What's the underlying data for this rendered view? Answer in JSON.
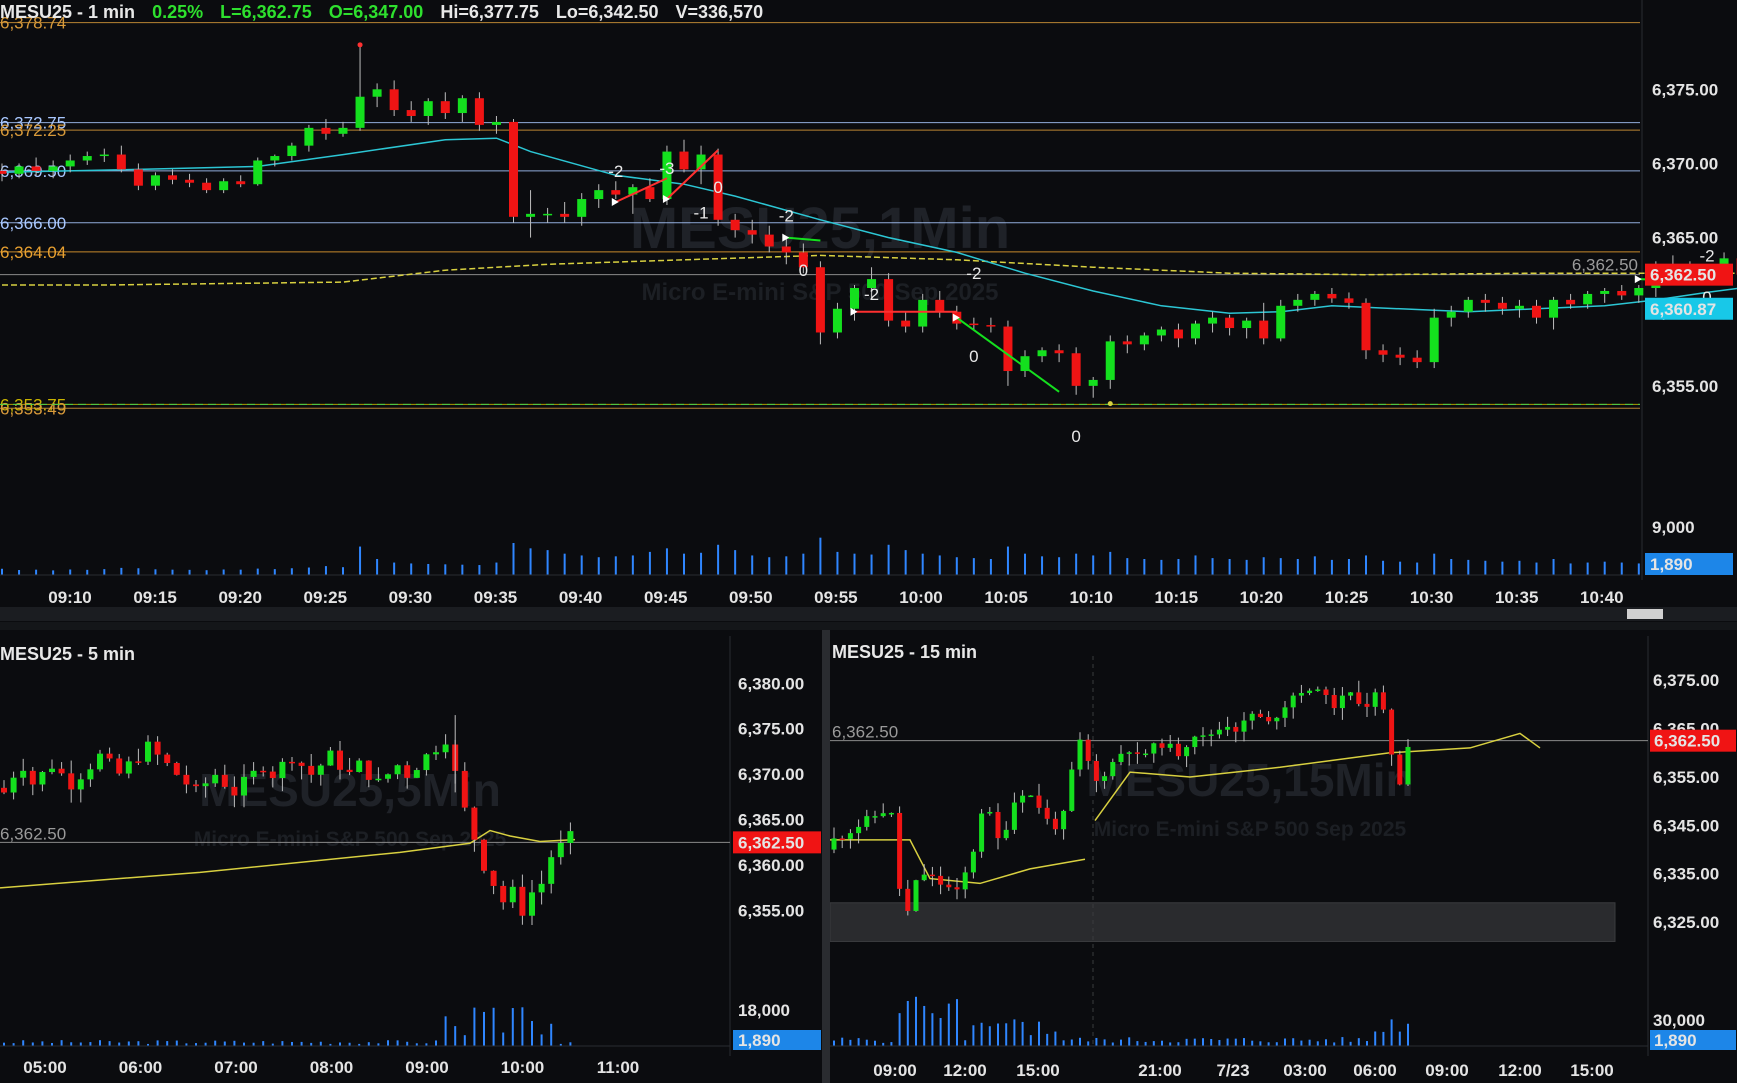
{
  "chart_data": [
    {
      "type": "candlestick",
      "symbol": "MESU25",
      "interval": "1 min",
      "header": {
        "symbol_label": "MESU25 - 1 min",
        "change": "0.25%",
        "last": "L=6,362.75",
        "open": "O=6,347.00",
        "high": "Hi=6,377.75",
        "low": "Lo=6,342.50",
        "volume": "V=336,570"
      },
      "watermark_title": "MESU25,1Min",
      "watermark_subtitle": "Micro E-mini S&P 500 Sep 2025",
      "ylim": [
        6350,
        6379
      ],
      "y_ticks": [
        "6,375.00",
        "6,370.00",
        "6,365.00",
        "6,360.00",
        "6,355.00"
      ],
      "y_tick_values": [
        6375,
        6370,
        6365,
        6360,
        6355
      ],
      "x_ticks": [
        "09:10",
        "09:15",
        "09:20",
        "09:25",
        "09:30",
        "09:35",
        "09:40",
        "09:45",
        "09:50",
        "09:55",
        "10:00",
        "10:05",
        "10:10",
        "10:15",
        "10:20",
        "10:25",
        "10:30",
        "10:35",
        "10:40"
      ],
      "x_start_minute": 0,
      "candles": [
        [
          6369.5,
          6370.0,
          6368.8,
          6369.3
        ],
        [
          6369.3,
          6370.0,
          6369.0,
          6369.8
        ],
        [
          6369.8,
          6370.4,
          6369.2,
          6369.5
        ],
        [
          6369.5,
          6370.2,
          6369.0,
          6369.8
        ],
        [
          6369.8,
          6370.6,
          6369.4,
          6370.2
        ],
        [
          6370.2,
          6370.8,
          6369.9,
          6370.5
        ],
        [
          6370.5,
          6371.0,
          6370.1,
          6370.6
        ],
        [
          6370.6,
          6371.2,
          6369.4,
          6369.6
        ],
        [
          6369.6,
          6370.0,
          6368.2,
          6368.5
        ],
        [
          6368.5,
          6369.4,
          6368.2,
          6369.2
        ],
        [
          6369.2,
          6369.6,
          6368.6,
          6368.9
        ],
        [
          6368.9,
          6369.3,
          6368.4,
          6368.7
        ],
        [
          6368.7,
          6369.0,
          6368.0,
          6368.2
        ],
        [
          6368.2,
          6369.0,
          6368.0,
          6368.8
        ],
        [
          6368.8,
          6369.2,
          6368.4,
          6368.6
        ],
        [
          6368.6,
          6370.4,
          6368.5,
          6370.2
        ],
        [
          6370.2,
          6370.6,
          6369.8,
          6370.5
        ],
        [
          6370.5,
          6371.4,
          6370.2,
          6371.2
        ],
        [
          6371.2,
          6372.6,
          6370.8,
          6372.4
        ],
        [
          6372.4,
          6373.0,
          6371.6,
          6372.0
        ],
        [
          6372.0,
          6372.8,
          6371.8,
          6372.4
        ],
        [
          6372.4,
          6378.0,
          6372.2,
          6374.5
        ],
        [
          6374.5,
          6375.4,
          6373.8,
          6375.0
        ],
        [
          6375.0,
          6375.6,
          6373.2,
          6373.6
        ],
        [
          6373.6,
          6374.2,
          6372.8,
          6373.2
        ],
        [
          6373.2,
          6374.4,
          6372.6,
          6374.2
        ],
        [
          6374.2,
          6374.8,
          6373.0,
          6373.4
        ],
        [
          6373.4,
          6374.6,
          6372.8,
          6374.4
        ],
        [
          6374.4,
          6374.8,
          6372.2,
          6372.6
        ],
        [
          6372.6,
          6373.2,
          6372.0,
          6372.8
        ],
        [
          6372.8,
          6373.0,
          6366.0,
          6366.4
        ],
        [
          6366.4,
          6368.2,
          6365.0,
          6366.6
        ],
        [
          6366.6,
          6367.0,
          6366.0,
          6366.6
        ],
        [
          6366.6,
          6367.4,
          6366.0,
          6366.4
        ],
        [
          6366.4,
          6368.0,
          6365.8,
          6367.6
        ],
        [
          6367.6,
          6368.6,
          6367.0,
          6368.2
        ],
        [
          6368.2,
          6368.8,
          6367.6,
          6367.9
        ],
        [
          6367.9,
          6368.6,
          6366.6,
          6368.4
        ],
        [
          6368.4,
          6369.0,
          6367.4,
          6367.6
        ],
        [
          6367.6,
          6371.2,
          6367.2,
          6370.8
        ],
        [
          6370.8,
          6371.6,
          6369.4,
          6369.6
        ],
        [
          6369.6,
          6371.2,
          6368.6,
          6370.6
        ],
        [
          6370.6,
          6371.0,
          6365.8,
          6366.2
        ],
        [
          6366.2,
          6366.6,
          6365.0,
          6365.5
        ],
        [
          6365.5,
          6366.2,
          6364.6,
          6365.2
        ],
        [
          6365.2,
          6365.8,
          6364.0,
          6364.4
        ],
        [
          6364.4,
          6365.0,
          6363.2,
          6364.0
        ],
        [
          6364.0,
          6364.6,
          6362.6,
          6363.0
        ],
        [
          6363.0,
          6363.4,
          6357.8,
          6358.6
        ],
        [
          6358.6,
          6360.6,
          6358.2,
          6360.2
        ],
        [
          6360.2,
          6361.8,
          6359.4,
          6361.6
        ],
        [
          6361.6,
          6363.0,
          6360.8,
          6362.2
        ],
        [
          6362.2,
          6362.6,
          6359.0,
          6359.4
        ],
        [
          6359.4,
          6360.0,
          6358.6,
          6359.0
        ],
        [
          6359.0,
          6361.2,
          6358.6,
          6360.8
        ],
        [
          6360.8,
          6361.4,
          6359.6,
          6360.0
        ],
        [
          6360.0,
          6360.4,
          6358.8,
          6359.2
        ],
        [
          6359.2,
          6359.6,
          6358.8,
          6359.1
        ],
        [
          6359.1,
          6359.6,
          6358.6,
          6359.0
        ],
        [
          6359.0,
          6359.4,
          6355.0,
          6356.0
        ],
        [
          6356.0,
          6357.4,
          6355.6,
          6357.0
        ],
        [
          6357.0,
          6357.6,
          6356.6,
          6357.4
        ],
        [
          6357.4,
          6357.8,
          6356.6,
          6357.2
        ],
        [
          6357.2,
          6357.6,
          6354.4,
          6355.0
        ],
        [
          6355.0,
          6355.6,
          6354.2,
          6355.4
        ],
        [
          6355.4,
          6358.4,
          6354.8,
          6358.0
        ],
        [
          6358.0,
          6358.4,
          6357.2,
          6357.8
        ],
        [
          6357.8,
          6358.6,
          6357.4,
          6358.4
        ],
        [
          6358.4,
          6359.0,
          6358.0,
          6358.8
        ],
        [
          6358.8,
          6359.2,
          6357.6,
          6358.2
        ],
        [
          6358.2,
          6359.4,
          6357.8,
          6359.2
        ],
        [
          6359.2,
          6360.0,
          6358.6,
          6359.6
        ],
        [
          6359.6,
          6359.8,
          6358.4,
          6358.9
        ],
        [
          6358.9,
          6359.6,
          6358.2,
          6359.4
        ],
        [
          6359.4,
          6360.6,
          6357.8,
          6358.2
        ],
        [
          6358.2,
          6360.8,
          6358.0,
          6360.4
        ],
        [
          6360.4,
          6361.2,
          6360.0,
          6360.8
        ],
        [
          6360.8,
          6361.4,
          6360.4,
          6361.2
        ],
        [
          6361.2,
          6361.6,
          6360.6,
          6360.9
        ],
        [
          6360.9,
          6361.3,
          6360.2,
          6360.6
        ],
        [
          6360.6,
          6360.9,
          6356.8,
          6357.4
        ],
        [
          6357.4,
          6357.8,
          6356.6,
          6357.1
        ],
        [
          6357.1,
          6357.6,
          6356.4,
          6356.9
        ],
        [
          6356.9,
          6357.4,
          6356.2,
          6356.6
        ],
        [
          6356.6,
          6360.2,
          6356.2,
          6359.6
        ],
        [
          6359.6,
          6360.4,
          6359.0,
          6360.0
        ],
        [
          6360.0,
          6361.0,
          6359.6,
          6360.8
        ],
        [
          6360.8,
          6361.2,
          6360.0,
          6360.6
        ],
        [
          6360.6,
          6361.0,
          6359.8,
          6360.2
        ],
        [
          6360.2,
          6360.8,
          6359.6,
          6360.4
        ],
        [
          6360.4,
          6360.8,
          6359.2,
          6359.6
        ],
        [
          6359.6,
          6361.0,
          6358.8,
          6360.8
        ],
        [
          6360.8,
          6361.2,
          6360.2,
          6360.5
        ],
        [
          6360.5,
          6361.4,
          6360.2,
          6361.2
        ],
        [
          6361.2,
          6361.6,
          6360.6,
          6361.4
        ],
        [
          6361.4,
          6361.8,
          6360.8,
          6361.1
        ],
        [
          6361.1,
          6361.8,
          6360.6,
          6361.6
        ],
        [
          6361.6,
          6363.4,
          6361.0,
          6363.2
        ],
        [
          6363.2,
          6363.8,
          6362.6,
          6363.0
        ],
        [
          6363.0,
          6363.4,
          6362.2,
          6362.6
        ],
        [
          6362.6,
          6363.0,
          6362.2,
          6362.8
        ],
        [
          6362.8,
          6364.0,
          6362.4,
          6363.6
        ],
        [
          6363.6,
          6364.2,
          6362.2,
          6362.5
        ]
      ],
      "volumes": [
        350,
        280,
        300,
        260,
        310,
        290,
        330,
        400,
        380,
        320,
        300,
        290,
        270,
        310,
        300,
        360,
        330,
        380,
        420,
        500,
        440,
        1600,
        900,
        700,
        650,
        620,
        600,
        580,
        560,
        700,
        1800,
        1500,
        1400,
        1200,
        1100,
        1000,
        1050,
        1100,
        1300,
        1500,
        1200,
        1250,
        1700,
        1400,
        1100,
        1000,
        1050,
        1200,
        2100,
        1300,
        1200,
        1150,
        1700,
        1400,
        1200,
        1100,
        1000,
        950,
        900,
        1600,
        1200,
        1050,
        1000,
        1200,
        1100,
        1300,
        950,
        900,
        850,
        900,
        1100,
        950,
        900,
        850,
        1000,
        950,
        900,
        1050,
        850,
        900,
        1100,
        800,
        750,
        700,
        1200,
        900,
        850,
        800,
        750,
        800,
        700,
        900,
        650,
        700,
        750,
        700,
        650,
        800,
        700,
        650,
        600,
        900,
        650
      ],
      "ema_cyan_points": [
        [
          0,
          6369.4
        ],
        [
          8,
          6369.6
        ],
        [
          15,
          6369.8
        ],
        [
          20,
          6370.6
        ],
        [
          26,
          6371.6
        ],
        [
          29,
          6371.7
        ],
        [
          31,
          6370.8
        ],
        [
          36,
          6369.2
        ],
        [
          40,
          6368.6
        ],
        [
          43,
          6367.8
        ],
        [
          48,
          6366.2
        ],
        [
          52,
          6365.0
        ],
        [
          56,
          6364.0
        ],
        [
          60,
          6362.6
        ],
        [
          64,
          6361.4
        ],
        [
          68,
          6360.4
        ],
        [
          72,
          6359.9
        ],
        [
          75,
          6360.0
        ],
        [
          78,
          6360.4
        ],
        [
          82,
          6360.2
        ],
        [
          86,
          6360.0
        ],
        [
          90,
          6360.2
        ],
        [
          94,
          6360.4
        ],
        [
          97,
          6360.8
        ],
        [
          100,
          6361.3
        ],
        [
          102,
          6361.6
        ]
      ],
      "sma_yellow_points": [
        [
          0,
          6361.8
        ],
        [
          6,
          6361.8
        ],
        [
          20,
          6362.0
        ],
        [
          26,
          6362.8
        ],
        [
          32,
          6363.2
        ],
        [
          40,
          6363.5
        ],
        [
          48,
          6363.8
        ],
        [
          56,
          6363.5
        ],
        [
          64,
          6363.0
        ],
        [
          72,
          6362.6
        ],
        [
          80,
          6362.5
        ],
        [
          90,
          6362.6
        ],
        [
          100,
          6362.6
        ],
        [
          102,
          6362.6
        ]
      ],
      "levels": [
        {
          "price": 6379.5,
          "color": "#d89a3a",
          "label": "6,378.74"
        },
        {
          "price": 6372.75,
          "color": "#a9c8ff",
          "label": "6,372.75"
        },
        {
          "price": 6372.25,
          "color": "#d89a3a",
          "label": "6,372.25"
        },
        {
          "price": 6369.5,
          "color": "#a9c8ff",
          "label": "6,369.50"
        },
        {
          "price": 6366.0,
          "color": "#a9c8ff",
          "label": "6,366.00"
        },
        {
          "price": 6364.04,
          "color": "#e8a030",
          "label": "6,364.04"
        },
        {
          "price": 6353.75,
          "color": "#c9b400",
          "label": "6,353.75"
        },
        {
          "price": 6353.49,
          "color": "#d89a3a",
          "label": "6,353.49"
        }
      ],
      "last_price_label": "6,362.50",
      "last_price": 6362.5,
      "ema_label": "6,360.87",
      "volume_tick": "9,000",
      "volume_label": "1,890",
      "signals": [
        {
          "bar": 36,
          "price": 6369.1,
          "text": "-2"
        },
        {
          "bar": 39,
          "price": 6369.3,
          "text": "-3"
        },
        {
          "bar": 41,
          "price": 6366.3,
          "text": "-1"
        },
        {
          "bar": 42,
          "price": 6368.0,
          "text": "0"
        },
        {
          "bar": 46,
          "price": 6366.1,
          "text": "-2"
        },
        {
          "bar": 47,
          "price": 6362.4,
          "text": "0"
        },
        {
          "bar": 51,
          "price": 6360.8,
          "text": "-2"
        },
        {
          "bar": 57,
          "price": 6362.2,
          "text": "-2"
        },
        {
          "bar": 57,
          "price": 6356.6,
          "text": "0"
        },
        {
          "bar": 63,
          "price": 6351.2,
          "text": "0"
        },
        {
          "bar": 100,
          "price": 6363.4,
          "text": "-2"
        },
        {
          "bar": 100,
          "price": 6360.6,
          "text": "0"
        }
      ]
    },
    {
      "type": "candlestick",
      "symbol": "MESU25",
      "interval": "5 min",
      "header": {
        "symbol_label": "MESU25 - 5 min"
      },
      "watermark_title": "MESU25,5Min",
      "watermark_subtitle": "Micro E-mini S&P 500 Sep 2025",
      "ylim": [
        6350,
        6383
      ],
      "y_ticks": [
        "6,380.00",
        "6,375.00",
        "6,370.00",
        "6,365.00",
        "6,360.00",
        "6,355.00"
      ],
      "y_tick_values": [
        6380,
        6375,
        6370,
        6365,
        6360,
        6355
      ],
      "x_ticks": [
        "05:00",
        "06:00",
        "07:00",
        "08:00",
        "09:00",
        "10:00",
        "11:00"
      ],
      "price_label": "6,362.50",
      "last_price": 6362.5,
      "volume_tick": "18,000",
      "volume_label": "1,890"
    },
    {
      "type": "candlestick",
      "symbol": "MESU25",
      "interval": "15 min",
      "header": {
        "symbol_label": "MESU25 - 15 min"
      },
      "watermark_title": "MESU25,15Min",
      "watermark_subtitle": "Micro E-mini S&P 500 Sep 2025",
      "ylim": [
        6318,
        6380
      ],
      "y_ticks": [
        "6,375.00",
        "6,365.00",
        "6,355.00",
        "6,345.00",
        "6,335.00",
        "6,325.00"
      ],
      "y_tick_values": [
        6375,
        6365,
        6355,
        6345,
        6335,
        6325
      ],
      "x_ticks": [
        "09:00",
        "12:00",
        "15:00",
        "21:00",
        "7/23",
        "03:00",
        "06:00",
        "09:00",
        "12:00",
        "15:00"
      ],
      "price_label": "6,362.50",
      "last_price": 6362.5,
      "volume_tick": "30,000",
      "volume_label": "1,890"
    }
  ],
  "colors": {
    "up": "#14e01e",
    "down": "#f01414",
    "background": "#0b0c0f",
    "last_price_box": "#f01414",
    "ema_box": "#18c8e8",
    "volume": "#2f86ff"
  }
}
